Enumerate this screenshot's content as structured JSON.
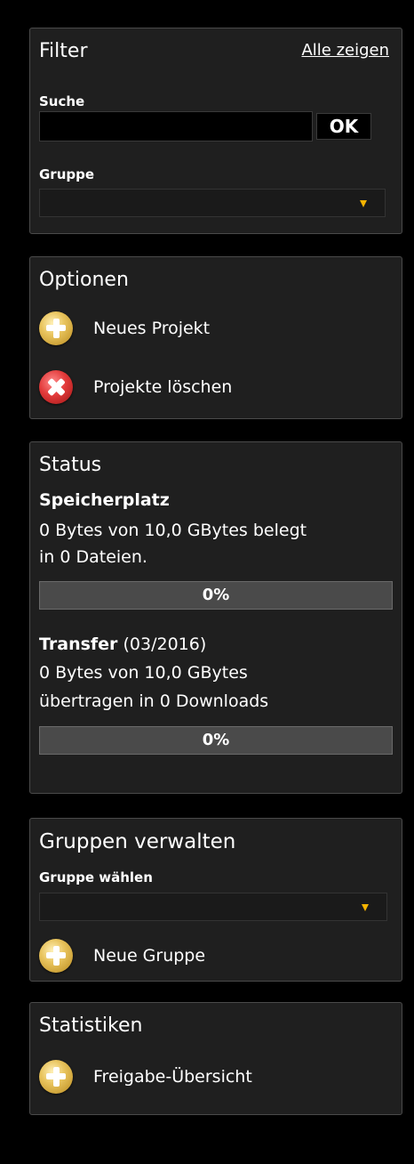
{
  "filter": {
    "title": "Filter",
    "show_all": "Alle zeigen",
    "search_label": "Suche",
    "search_value": "",
    "ok_label": "OK",
    "group_label": "Gruppe",
    "group_selected": ""
  },
  "options": {
    "title": "Optionen",
    "new_project": "Neues Projekt",
    "delete_projects": "Projekte löschen"
  },
  "status": {
    "title": "Status",
    "storage": {
      "heading": "Speicherplatz",
      "line1": "0 Bytes von 10,0 GBytes belegt",
      "line2": "in 0 Dateien.",
      "percent": 0,
      "percent_label": "0%"
    },
    "transfer": {
      "heading": "Transfer",
      "period": "(03/2016)",
      "line1": "0 Bytes von 10,0 GBytes",
      "line2": "übertragen in 0 Downloads",
      "percent": 0,
      "percent_label": "0%"
    }
  },
  "groups": {
    "title": "Gruppen verwalten",
    "select_label": "Gruppe wählen",
    "select_value": "",
    "new_group": "Neue Gruppe"
  },
  "statistics": {
    "title": "Statistiken",
    "share_overview": "Freigabe-Übersicht"
  },
  "colors": {
    "background": "#000000",
    "panel": "#1f1f1f",
    "caret": "#f5b400",
    "plus_icon": "#e8c35c",
    "delete_icon": "#e23a3a"
  },
  "icons": {
    "add": "plus-circle-icon",
    "delete": "x-circle-icon",
    "dropdown": "caret-down-icon"
  }
}
